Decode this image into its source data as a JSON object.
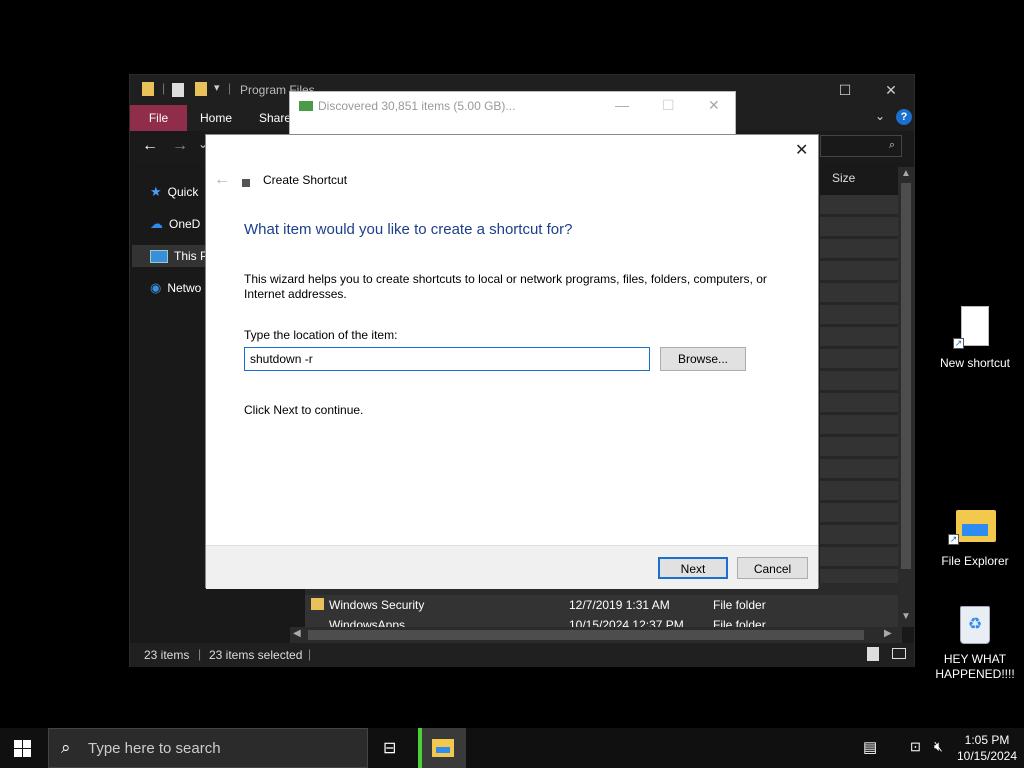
{
  "explorer": {
    "title": "Program Files",
    "ribbon_tabs": [
      "File",
      "Home",
      "Share"
    ],
    "nav": [
      {
        "label": "Quick",
        "icon": "star-icon"
      },
      {
        "label": "OneD",
        "icon": "cloud-icon"
      },
      {
        "label": "This P",
        "icon": "computer-icon"
      },
      {
        "label": "Netwo",
        "icon": "network-icon"
      }
    ],
    "column_size": "Size",
    "rows": [
      {
        "name": "Windows Security",
        "date": "12/7/2019 1:31 AM",
        "type": "File folder"
      },
      {
        "name": "WindowsApps",
        "date": "10/15/2024 12:37 PM",
        "type": "File folder"
      }
    ],
    "status_items": "23 items",
    "status_selected": "23 items selected"
  },
  "progress": {
    "title": "Discovered 30,851 items (5.00 GB)..."
  },
  "wizard": {
    "title": "Create Shortcut",
    "heading": "What item would you like to create a shortcut for?",
    "description": "This wizard helps you to create shortcuts to local or network programs, files, folders, computers, or Internet addresses.",
    "location_label": "Type the location of the item:",
    "location_value": "shutdown -r",
    "browse_label": "Browse...",
    "continue_text": "Click Next to continue.",
    "next_label": "Next",
    "cancel_label": "Cancel"
  },
  "desktop": {
    "icons": [
      {
        "label": "New shortcut",
        "icon": "shortcut-file-icon"
      },
      {
        "label": "File Explorer",
        "icon": "folder-icon"
      },
      {
        "label": "HEY WHAT HAPPENED!!!!",
        "icon": "recycle-bin-icon"
      }
    ]
  },
  "taskbar": {
    "search_placeholder": "Type here to search",
    "time": "1:05 PM",
    "date": "10/15/2024"
  },
  "colors": {
    "accent": "#1a6fcf",
    "file_tab": "#8f2d4a",
    "heading_blue": "#1c3f8c",
    "explorer_active": "#4cd137"
  }
}
